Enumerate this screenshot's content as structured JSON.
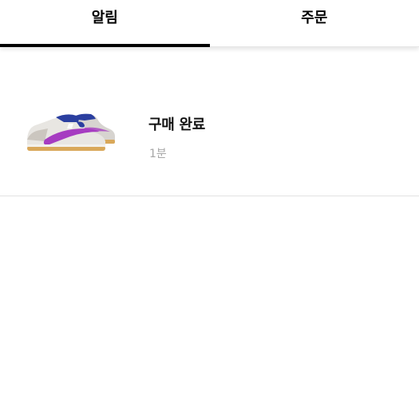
{
  "tabs": [
    {
      "label": "알림",
      "active": true
    },
    {
      "label": "주문",
      "active": false
    }
  ],
  "notifications": [
    {
      "title": "구매 완료",
      "time": "1분",
      "image": "sneaker-product-thumbnail"
    }
  ],
  "colors": {
    "active_indicator": "#000000",
    "time_text": "#a6a6a6",
    "divider": "#e3e3e3",
    "sneaker_swoosh": "#a63cc1",
    "sneaker_accent": "#2b3fa0",
    "sneaker_sole": "#d9a85a"
  }
}
